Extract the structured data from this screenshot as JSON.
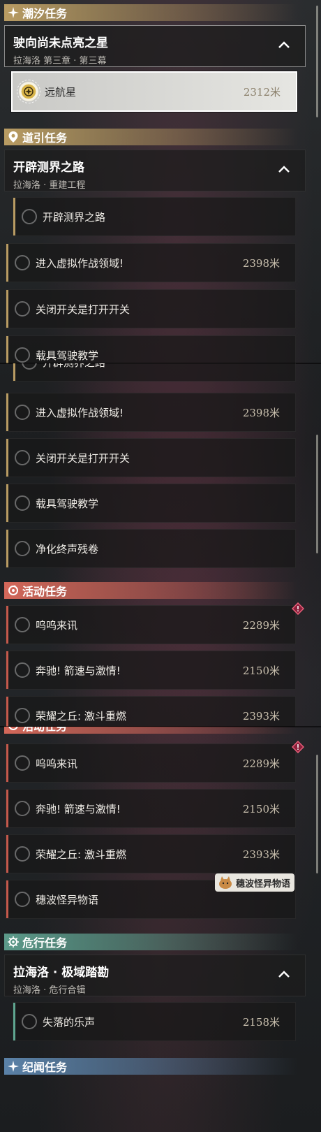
{
  "sections": {
    "tide": "潮汐任务",
    "guide": "道引任务",
    "event": "活动任务",
    "danger": "危行任务",
    "chronicle": "纪闻任务"
  },
  "tide_chapter": {
    "title": "驶向尚未点亮之星",
    "subtitle": "拉海洛 第三章 · 第三幕"
  },
  "tide_task": {
    "label": "远航星",
    "distance": "2312米"
  },
  "guide_chapter": {
    "title": "开辟测界之路",
    "subtitle": "拉海洛 · 重建工程"
  },
  "guide_tasks": [
    {
      "label": "开辟测界之路",
      "distance": ""
    },
    {
      "label": "进入虚拟作战领域!",
      "distance": "2398米"
    },
    {
      "label": "关闭开关是打开开关",
      "distance": ""
    },
    {
      "label": "载具驾驶教学",
      "distance": ""
    },
    {
      "label": "净化终声残卷",
      "distance": ""
    }
  ],
  "event_tasks": [
    {
      "label": "呜呜来讯",
      "distance": "2289米"
    },
    {
      "label": "奔驰! 箭速与激情!",
      "distance": "2150米"
    },
    {
      "label": "荣耀之丘: 激斗重燃",
      "distance": "2393米"
    },
    {
      "label": "穗波怪异物语",
      "distance": ""
    }
  ],
  "event_badge": "穗波怪异物语",
  "danger_chapter": {
    "title": "拉海洛 · 极域踏勘",
    "subtitle": "拉海洛 · 危行合辑"
  },
  "danger_task": {
    "label": "失落的乐声",
    "distance": "2158米"
  },
  "colors": {
    "gold": "#b99c63",
    "red": "#c5594c",
    "teal": "#5fa690",
    "blue": "#5b82a8"
  }
}
